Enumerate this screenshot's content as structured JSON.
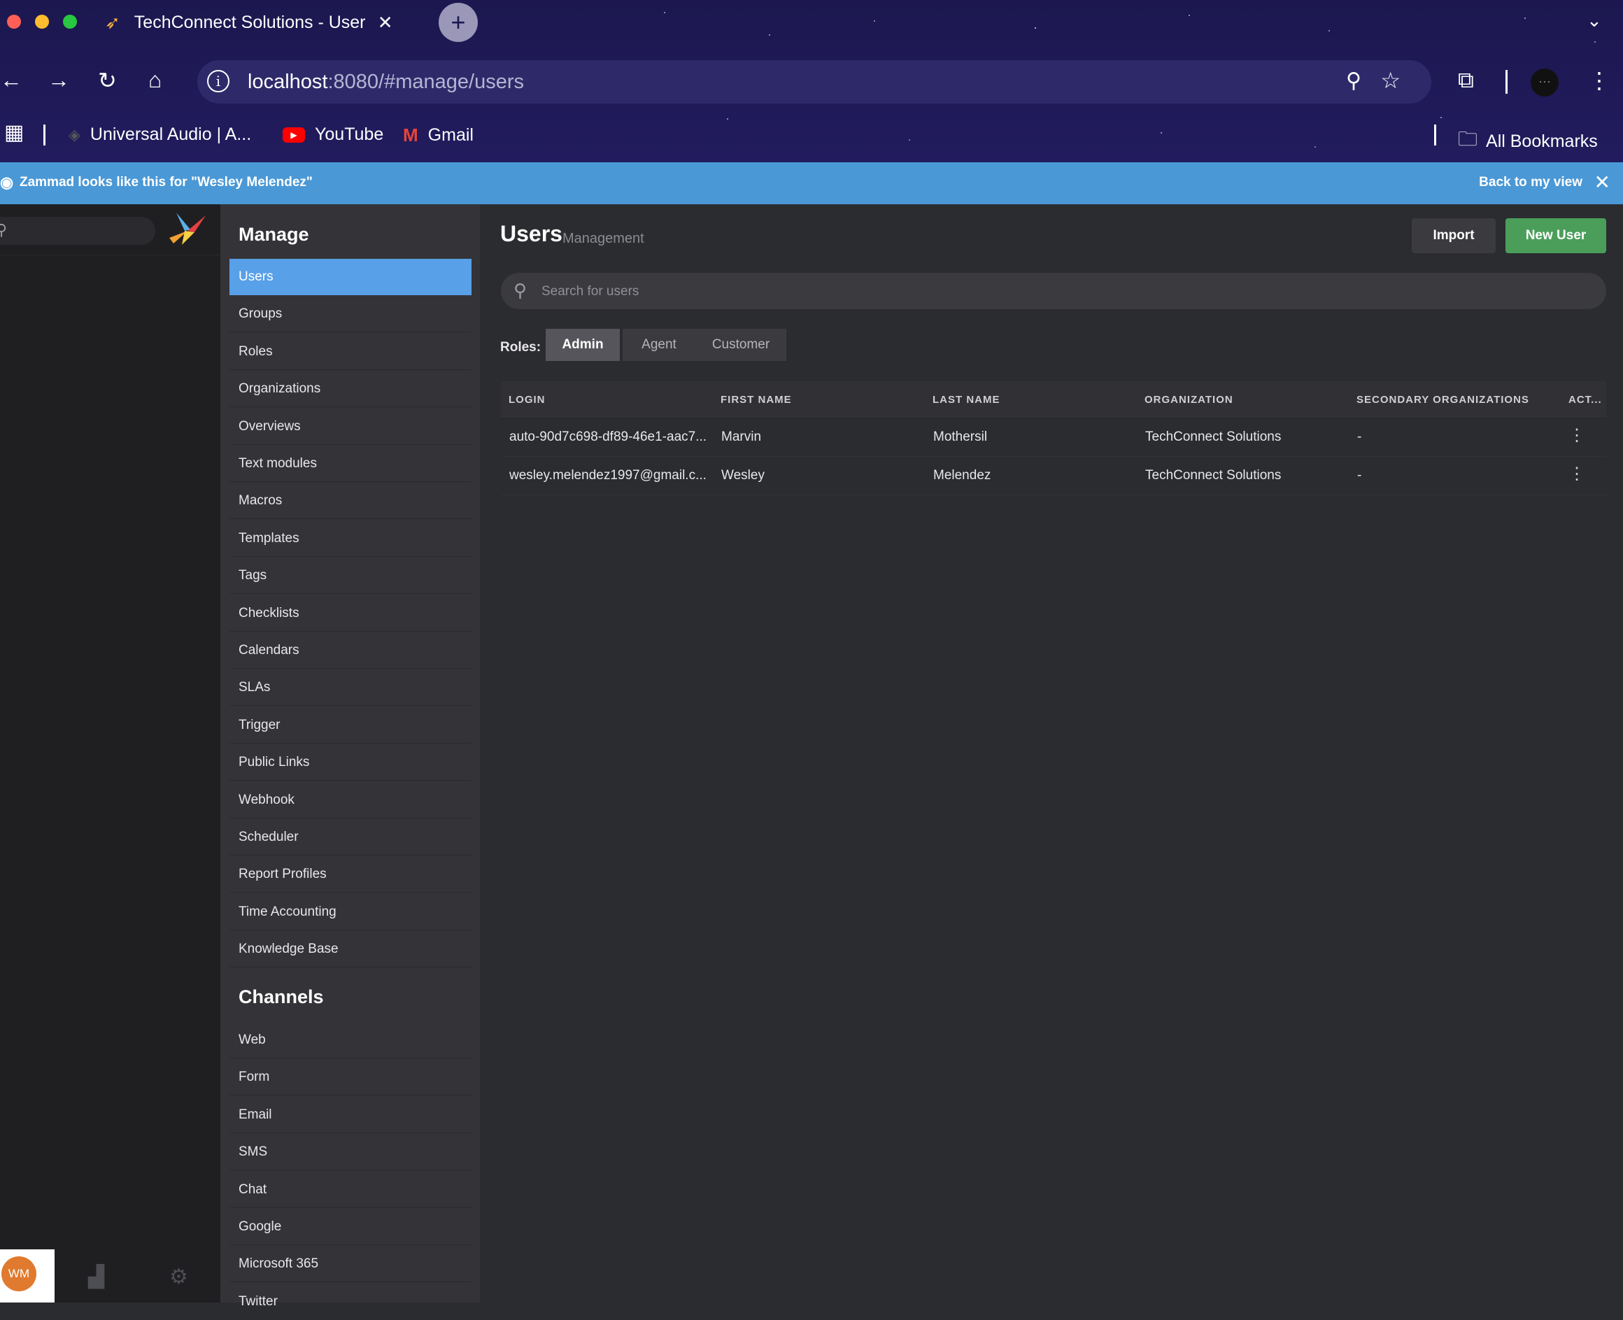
{
  "browser": {
    "tab_title": "TechConnect Solutions - Users",
    "url_host": "localhost",
    "url_rest": ":8080/#manage/users",
    "bookmarks": [
      "Universal Audio | A...",
      "YouTube",
      "Gmail"
    ],
    "all_bookmarks": "All Bookmarks"
  },
  "banner": {
    "text": "Zammad looks like this for \"Wesley Melendez\"",
    "back": "Back to my view"
  },
  "user": {
    "initials": "WM"
  },
  "manage": {
    "title": "Manage",
    "items": [
      "Users",
      "Groups",
      "Roles",
      "Organizations",
      "Overviews",
      "Text modules",
      "Macros",
      "Templates",
      "Tags",
      "Checklists",
      "Calendars",
      "SLAs",
      "Trigger",
      "Public Links",
      "Webhook",
      "Scheduler",
      "Report Profiles",
      "Time Accounting",
      "Knowledge Base"
    ],
    "active": "Users"
  },
  "channels": {
    "title": "Channels",
    "items": [
      "Web",
      "Form",
      "Email",
      "SMS",
      "Chat",
      "Google",
      "Microsoft 365",
      "Twitter"
    ]
  },
  "main": {
    "title": "Users",
    "subtitle": "Management",
    "import_label": "Import",
    "new_user_label": "New User",
    "search_placeholder": "Search for users",
    "roles_label": "Roles:",
    "roles": [
      "Admin",
      "Agent",
      "Customer"
    ],
    "active_role": "Admin",
    "columns": [
      "LOGIN",
      "FIRST NAME",
      "LAST NAME",
      "ORGANIZATION",
      "SECONDARY ORGANIZATIONS",
      "ACT..."
    ],
    "rows": [
      {
        "login": "auto-90d7c698-df89-46e1-aac7...",
        "first": "Marvin",
        "last": "Mothersil",
        "org": "TechConnect Solutions",
        "secondary": "-"
      },
      {
        "login": "wesley.melendez1997@gmail.c...",
        "first": "Wesley",
        "last": "Melendez",
        "org": "TechConnect Solutions",
        "secondary": "-"
      }
    ]
  },
  "colors": {
    "banner": "#4a98d6",
    "active_nav": "#58a0e8",
    "new_user": "#4b9e5a",
    "avatar": "#e07a2e"
  }
}
